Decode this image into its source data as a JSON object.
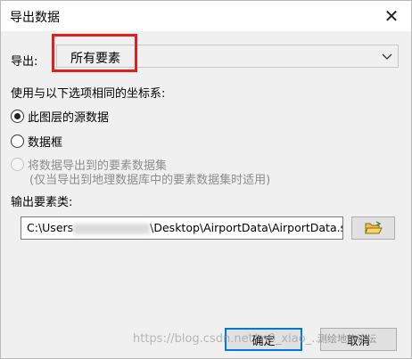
{
  "window": {
    "title": "导出数据",
    "close_glyph": "✕"
  },
  "export": {
    "label": "导出:",
    "selected_value": "所有要素"
  },
  "coords": {
    "label": "使用与以下选项相同的坐标系:",
    "options": [
      {
        "label": "此图层的源数据",
        "checked": true,
        "enabled": true
      },
      {
        "label": "数据框",
        "checked": false,
        "enabled": true
      },
      {
        "label": "将数据导出到的要素数据集",
        "sub": "(仅当导出到地理数据库中的要素数据集时适用)",
        "checked": false,
        "enabled": false
      }
    ]
  },
  "output": {
    "label": "输出要素类:",
    "path_prefix": "C:\\Users",
    "path_suffix": "\\Desktop\\AirportData\\AirportData.shp",
    "browse_icon": "folder-open-icon"
  },
  "buttons": {
    "ok": "确定",
    "cancel": "取消"
  },
  "watermark": {
    "url_text": "https://blog.csdn.net/m0_xiao_...",
    "brand_text": "测绘地信论坛"
  },
  "colors": {
    "highlight": "#e0201c",
    "focus_border": "#0078d7"
  }
}
